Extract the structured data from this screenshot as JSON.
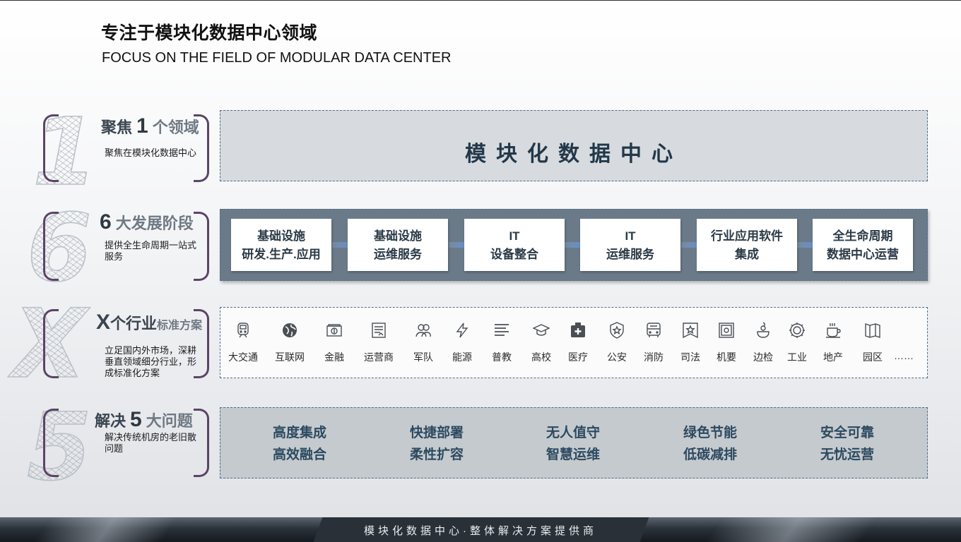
{
  "title_cn": "专注于模块化数据中心领域",
  "title_en": "FOCUS ON THE FIELD OF MODULAR DATA CENTER",
  "rows": [
    {
      "big": "1",
      "pre": "聚焦",
      "num": "1",
      "post": "个领域",
      "desc": "聚焦在模块化数据中心"
    },
    {
      "big": "6",
      "pre": "",
      "num": "6",
      "post": "大发展阶段",
      "desc": "提供全生命周期一站式服务"
    },
    {
      "big": "X",
      "pre": "",
      "num": "X",
      "post": "个行业",
      "post_small": "标准方案",
      "desc": "立足国内外市场，深耕垂直领域细分行业，形成标准化方案"
    },
    {
      "big": "5",
      "pre": "解决",
      "num": "5",
      "post": "大问题",
      "desc": "解决传统机房的老旧散问题"
    }
  ],
  "panel1_title": "模块化数据中心",
  "stages": [
    {
      "line1": "基础设施",
      "line2": "研发.生产.应用"
    },
    {
      "line1": "基础设施",
      "line2": "运维服务"
    },
    {
      "line1": "IT",
      "line2": "设备整合"
    },
    {
      "line1": "IT",
      "line2": "运维服务"
    },
    {
      "line1": "行业应用软件",
      "line2": "集成"
    },
    {
      "line1": "全生命周期",
      "line2": "数据中心运营"
    }
  ],
  "industries": [
    {
      "label": "大交通",
      "icon": "train-icon"
    },
    {
      "label": "互联网",
      "icon": "globe-icon"
    },
    {
      "label": "金融",
      "icon": "banknote-icon"
    },
    {
      "label": "运营商",
      "icon": "document-icon"
    },
    {
      "label": "军队",
      "icon": "people-icon"
    },
    {
      "label": "能源",
      "icon": "lightning-icon"
    },
    {
      "label": "普教",
      "icon": "text-lines-icon"
    },
    {
      "label": "高校",
      "icon": "graduation-cap-icon"
    },
    {
      "label": "医疗",
      "icon": "medical-kit-icon"
    },
    {
      "label": "公安",
      "icon": "police-badge-icon"
    },
    {
      "label": "消防",
      "icon": "fire-truck-icon"
    },
    {
      "label": "司法",
      "icon": "star-flag-icon"
    },
    {
      "label": "机要",
      "icon": "safe-icon"
    },
    {
      "label": "边检",
      "icon": "border-guard-icon"
    },
    {
      "label": "工业",
      "icon": "gear-icon"
    },
    {
      "label": "地产",
      "icon": "coffee-cup-icon"
    },
    {
      "label": "园区",
      "icon": "map-book-icon"
    }
  ],
  "industries_more": "……",
  "problems": [
    {
      "line1": "高度集成",
      "line2": "高效融合"
    },
    {
      "line1": "快捷部署",
      "line2": "柔性扩容"
    },
    {
      "line1": "无人值守",
      "line2": "智慧运维"
    },
    {
      "line1": "绿色节能",
      "line2": "低碳减排"
    },
    {
      "line1": "安全可靠",
      "line2": "无忧运营"
    }
  ],
  "footer": "模块化数据中心·整体解决方案提供商",
  "colors": {
    "accent_bracket": "#5b4467",
    "panel_dark": "#6b7a88",
    "text_dark_blue": "#23384a",
    "arrow_blue": "#4a8be0"
  }
}
